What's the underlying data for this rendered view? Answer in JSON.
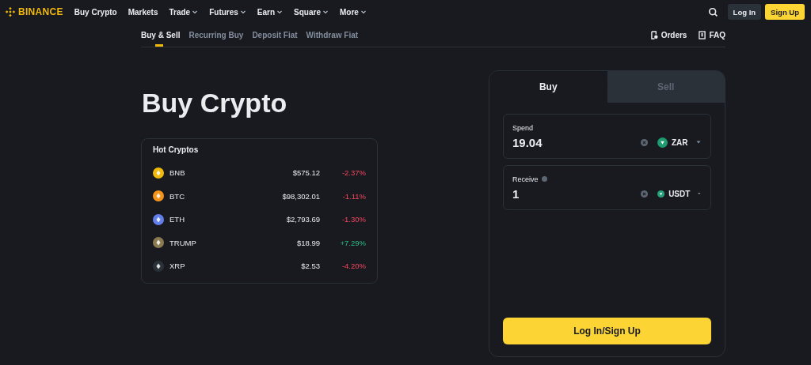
{
  "nav": {
    "brand": "BINANCE",
    "items": [
      {
        "label": "Buy Crypto",
        "dropdown": false
      },
      {
        "label": "Markets",
        "dropdown": false
      },
      {
        "label": "Trade",
        "dropdown": true
      },
      {
        "label": "Futures",
        "dropdown": true
      },
      {
        "label": "Earn",
        "dropdown": true
      },
      {
        "label": "Square",
        "dropdown": true
      },
      {
        "label": "More",
        "dropdown": true
      }
    ],
    "login": "Log In",
    "signup": "Sign Up"
  },
  "subnav": {
    "tabs": [
      {
        "label": "Buy & Sell",
        "selected": true
      },
      {
        "label": "Recurring Buy",
        "selected": false
      },
      {
        "label": "Deposit Fiat",
        "selected": false
      },
      {
        "label": "Withdraw Fiat",
        "selected": false
      }
    ],
    "orders": "Orders",
    "faq": "FAQ"
  },
  "title": "Buy Crypto",
  "hot": {
    "title": "Hot Cryptos",
    "rows": [
      {
        "symbol": "BNB",
        "color": "#f0b90b",
        "price": "$575.12",
        "change": "-2.37%",
        "up": false
      },
      {
        "symbol": "BTC",
        "color": "#f7931a",
        "price": "$98,302.01",
        "change": "-1.11%",
        "up": false
      },
      {
        "symbol": "ETH",
        "color": "#627eea",
        "price": "$2,793.69",
        "change": "-1.30%",
        "up": false
      },
      {
        "symbol": "TRUMP",
        "color": "#8a7a50",
        "price": "$18.99",
        "change": "+7.29%",
        "up": true
      },
      {
        "symbol": "XRP",
        "color": "#2b3139",
        "price": "$2.53",
        "change": "-4.20%",
        "up": false
      }
    ]
  },
  "trade": {
    "tabs": [
      {
        "label": "Buy",
        "selected": true
      },
      {
        "label": "Sell",
        "selected": false
      }
    ],
    "fields": [
      {
        "label": "Spend",
        "info": false,
        "value": "19.04",
        "currency": "ZAR",
        "color": "#1c9c6f"
      },
      {
        "label": "Receive",
        "info": true,
        "value": "1",
        "currency": "USDT",
        "color": "#26a17b"
      }
    ],
    "button": "Log In/Sign Up"
  }
}
